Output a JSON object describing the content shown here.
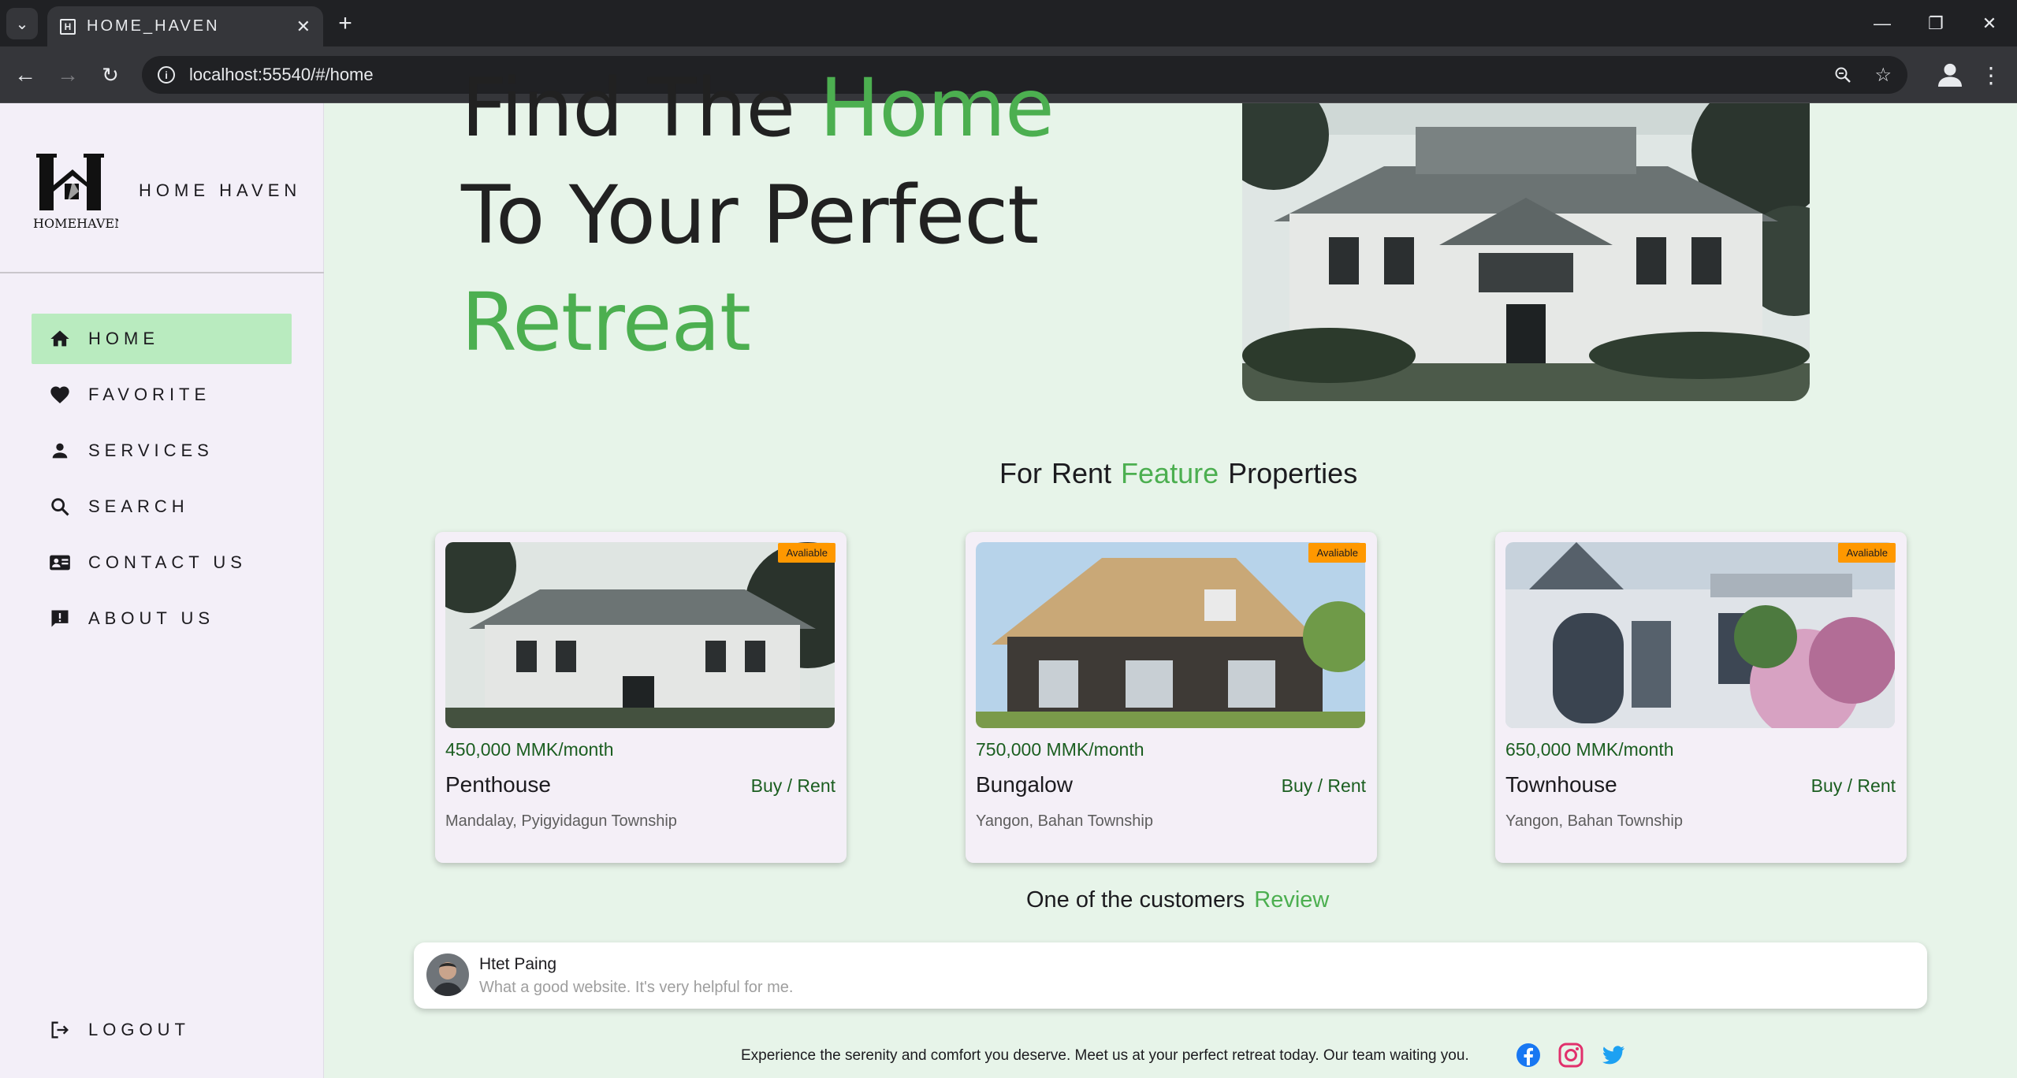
{
  "browser": {
    "tab_title": "HOME_HAVEN",
    "url": "localhost:55540/#/home"
  },
  "sidebar": {
    "brand_name": "HOME HAVEN",
    "logo_text": "HOMEHAVEN",
    "items": [
      {
        "label": "HOME",
        "icon": "home-icon",
        "active": true
      },
      {
        "label": "FAVORITE",
        "icon": "heart-icon",
        "active": false
      },
      {
        "label": "SERVICES",
        "icon": "person-icon",
        "active": false
      },
      {
        "label": "SEARCH",
        "icon": "search-icon",
        "active": false
      },
      {
        "label": "CONTACT US",
        "icon": "contact-card-icon",
        "active": false
      },
      {
        "label": "ABOUT US",
        "icon": "feedback-icon",
        "active": false
      }
    ],
    "logout_label": "LOGOUT"
  },
  "hero": {
    "line1_a": "Find The ",
    "line1_b": "Home",
    "line2": "To Your Perfect",
    "line3": "Retreat"
  },
  "featured": {
    "title_for": "For",
    "title_rent": "Rent",
    "title_feature": "Feature",
    "title_properties": "Properties",
    "cards": [
      {
        "badge": "Avaliable",
        "price": "450,000 MMK/month",
        "name": "Penthouse",
        "action": "Buy / Rent",
        "location": "Mandalay, Pyigyidagun Township"
      },
      {
        "badge": "Avaliable",
        "price": "750,000 MMK/month",
        "name": "Bungalow",
        "action": "Buy / Rent",
        "location": "Yangon, Bahan Township"
      },
      {
        "badge": "Avaliable",
        "price": "650,000 MMK/month",
        "name": "Townhouse",
        "action": "Buy / Rent",
        "location": "Yangon, Bahan Township"
      }
    ]
  },
  "reviews": {
    "title_a": "One of the customers",
    "title_b": "Review",
    "name": "Htet Paing",
    "text": "What a good website. It's very helpful for me."
  },
  "footer": {
    "text": "Experience the serenity and comfort you deserve. Meet us at your perfect retreat today. Our team waiting you.",
    "socials": [
      "facebook-icon",
      "instagram-icon",
      "twitter-icon"
    ]
  },
  "colors": {
    "accent_green": "#4caf50",
    "dark_green": "#1b5e20",
    "active_nav": "#b9ebbf",
    "badge_orange": "#ff9800",
    "page_bg": "#e7f4e9"
  }
}
